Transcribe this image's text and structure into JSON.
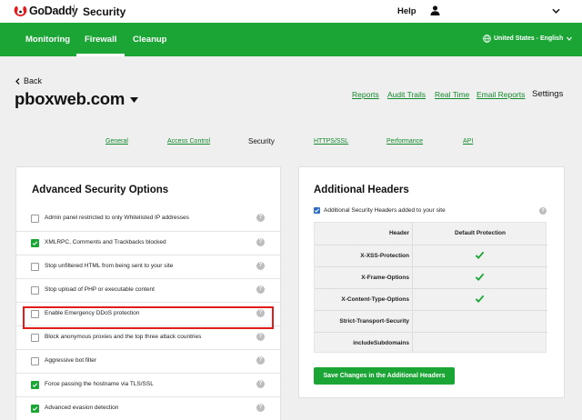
{
  "brand": {
    "name": "GoDaddy",
    "section": "Security"
  },
  "topbar": {
    "help": "Help"
  },
  "nav": {
    "items": [
      {
        "label": "Monitoring",
        "active": false
      },
      {
        "label": "Firewall",
        "active": true
      },
      {
        "label": "Cleanup",
        "active": false
      }
    ],
    "locale": "United States - English"
  },
  "header": {
    "back": "Back",
    "site": "pboxweb.com",
    "links": [
      "Reports",
      "Audit Trails",
      "Real Time",
      "Email Reports"
    ],
    "current": "Settings"
  },
  "tabs": {
    "links": [
      "General",
      "Access Control"
    ],
    "current": "Security",
    "links_after": [
      "HTTPS/SSL",
      "Performance",
      "API"
    ]
  },
  "advanced": {
    "title": "Advanced Security Options",
    "options": [
      {
        "label": "Admin panel restricted to only Whitelisted IP addresses",
        "checked": false
      },
      {
        "label": "XMLRPC, Comments and Trackbacks blocked",
        "checked": true
      },
      {
        "label": "Stop unfiltered HTML from being sent to your site",
        "checked": false
      },
      {
        "label": "Stop upload of PHP or executable content",
        "checked": false
      },
      {
        "label": "Enable Emergency DDoS protection",
        "checked": false
      },
      {
        "label": "Block anonymous proxies and the top three attack countries",
        "checked": false
      },
      {
        "label": "Aggressive bot filter",
        "checked": false
      },
      {
        "label": "Force passing the hostname via TLS/SSL",
        "checked": true
      },
      {
        "label": "Advanced evasion detection",
        "checked": true
      }
    ],
    "help_glyph": "?"
  },
  "additional": {
    "title": "Additional Headers",
    "added_label": "Additional Security Headers added to your site",
    "added_checked": true,
    "columns": [
      "Header",
      "Default Protection"
    ],
    "rows": [
      {
        "name": "X-XSS-Protection",
        "default": true
      },
      {
        "name": "X-Frame-Options",
        "default": true
      },
      {
        "name": "X-Content-Type-Options",
        "default": true
      },
      {
        "name": "Strict-Transport-Security",
        "default": false
      },
      {
        "name": "includeSubdomains",
        "default": false
      }
    ],
    "save_label": "Save Changes in the Additional Headers"
  },
  "colors": {
    "brand_green": "#1aa535",
    "link_green": "#138a2c",
    "highlight_red": "#e31b1b"
  }
}
